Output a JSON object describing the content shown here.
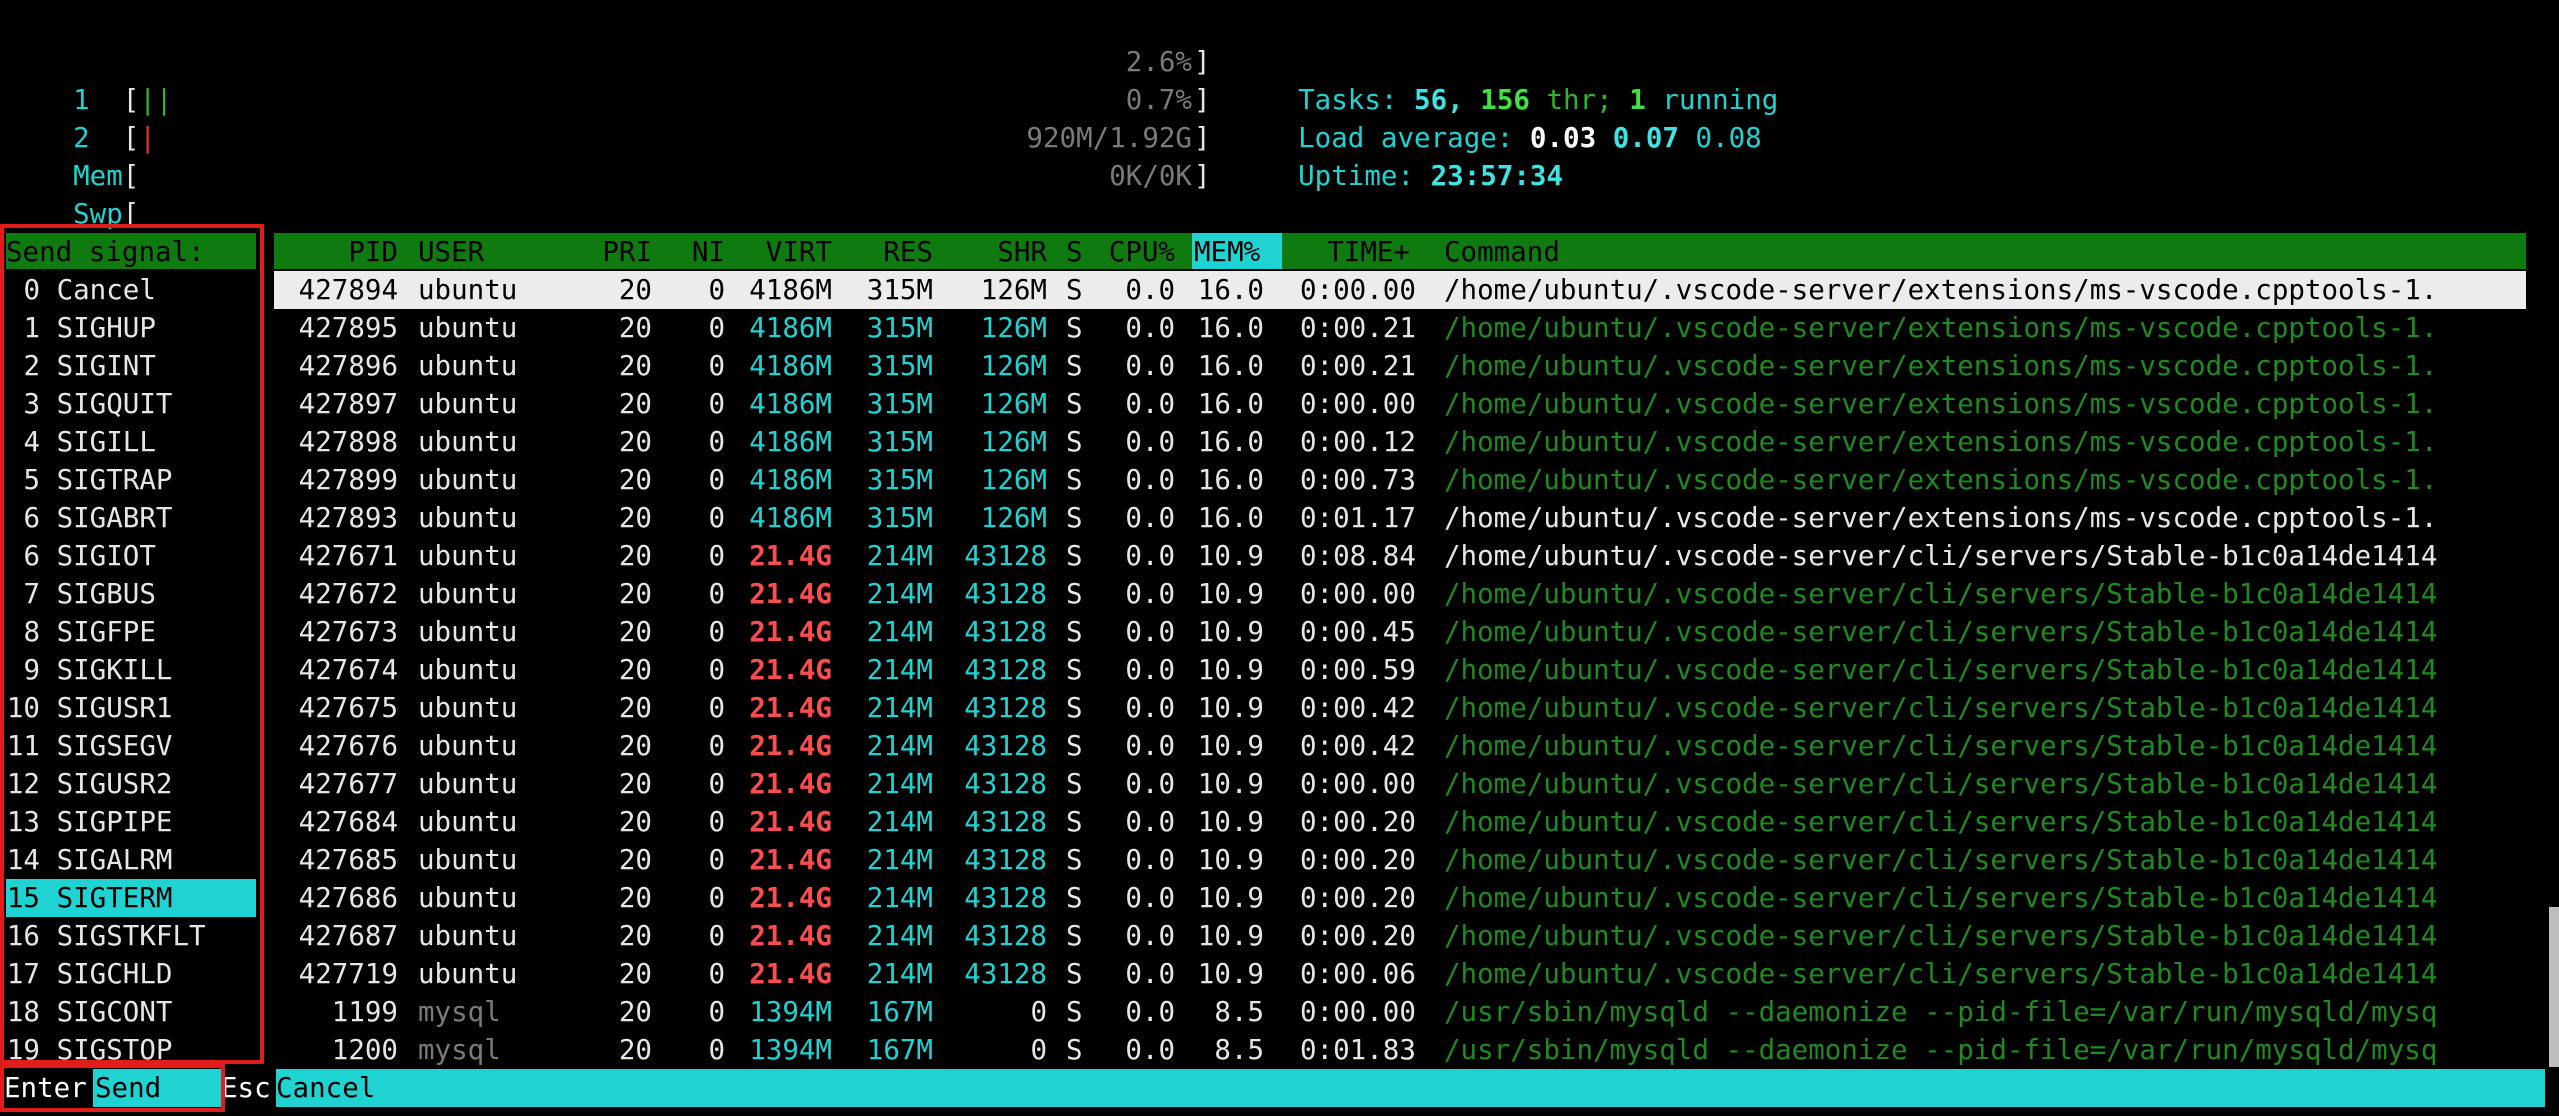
{
  "meters": {
    "cpu1": {
      "label": "1",
      "bar": "||",
      "value": "2.6%"
    },
    "cpu2": {
      "label": "2",
      "bar": "|",
      "value": "0.7%"
    },
    "mem": {
      "label": "Mem",
      "bar_green": "||||||||||||||||||||||||||||||||||||||||||||||||||||||||||||||||||||||",
      "bar_blue": "|||",
      "bar_yellow": "||||||||||||||||||||||||||||||",
      "value": "920M/1.92G"
    },
    "swp": {
      "label": "Swp",
      "value": "0K/0K"
    }
  },
  "summary": {
    "tasks_label": "Tasks:",
    "tasks": "56,",
    "threads": "156",
    "thr_label": "thr;",
    "running": "1",
    "running_label": "running",
    "load_label": "Load average:",
    "load1": "0.03",
    "load5": "0.07",
    "load15": "0.08",
    "uptime_label": "Uptime:",
    "uptime": "23:57:34"
  },
  "signal_panel": {
    "title": "Send signal:",
    "items": [
      {
        "num": "0",
        "name": "Cancel"
      },
      {
        "num": "1",
        "name": "SIGHUP"
      },
      {
        "num": "2",
        "name": "SIGINT"
      },
      {
        "num": "3",
        "name": "SIGQUIT"
      },
      {
        "num": "4",
        "name": "SIGILL"
      },
      {
        "num": "5",
        "name": "SIGTRAP"
      },
      {
        "num": "6",
        "name": "SIGABRT"
      },
      {
        "num": "6",
        "name": "SIGIOT"
      },
      {
        "num": "7",
        "name": "SIGBUS"
      },
      {
        "num": "8",
        "name": "SIGFPE"
      },
      {
        "num": "9",
        "name": "SIGKILL"
      },
      {
        "num": "10",
        "name": "SIGUSR1"
      },
      {
        "num": "11",
        "name": "SIGSEGV"
      },
      {
        "num": "12",
        "name": "SIGUSR2"
      },
      {
        "num": "13",
        "name": "SIGPIPE"
      },
      {
        "num": "14",
        "name": "SIGALRM"
      },
      {
        "num": "15",
        "name": "SIGTERM"
      },
      {
        "num": "16",
        "name": "SIGSTKFLT"
      },
      {
        "num": "17",
        "name": "SIGCHLD"
      },
      {
        "num": "18",
        "name": "SIGCONT"
      },
      {
        "num": "19",
        "name": "SIGSTOP"
      }
    ],
    "selected_index": 16
  },
  "table": {
    "headers": {
      "pid": "PID",
      "user": "USER",
      "pri": "PRI",
      "ni": "NI",
      "virt": "VIRT",
      "res": "RES",
      "shr": "SHR",
      "s": "S",
      "cpu": "CPU%",
      "mem": "MEM%",
      "time": "TIME+",
      "command": "Command"
    },
    "rows": [
      {
        "pid": "427894",
        "user": "ubuntu",
        "pri": "20",
        "ni": "0",
        "virt": "4186M",
        "res": "315M",
        "shr": "126M",
        "s": "S",
        "cpu": "0.0",
        "mem": "16.0",
        "time": "0:00.00",
        "cmd": "/home/ubuntu/.vscode-server/extensions/ms-vscode.cpptools-1.",
        "kind": "sel"
      },
      {
        "pid": "427895",
        "user": "ubuntu",
        "pri": "20",
        "ni": "0",
        "virt": "4186M",
        "res": "315M",
        "shr": "126M",
        "s": "S",
        "cpu": "0.0",
        "mem": "16.0",
        "time": "0:00.21",
        "cmd": "/home/ubuntu/.vscode-server/extensions/ms-vscode.cpptools-1.",
        "kind": "thr"
      },
      {
        "pid": "427896",
        "user": "ubuntu",
        "pri": "20",
        "ni": "0",
        "virt": "4186M",
        "res": "315M",
        "shr": "126M",
        "s": "S",
        "cpu": "0.0",
        "mem": "16.0",
        "time": "0:00.21",
        "cmd": "/home/ubuntu/.vscode-server/extensions/ms-vscode.cpptools-1.",
        "kind": "thr"
      },
      {
        "pid": "427897",
        "user": "ubuntu",
        "pri": "20",
        "ni": "0",
        "virt": "4186M",
        "res": "315M",
        "shr": "126M",
        "s": "S",
        "cpu": "0.0",
        "mem": "16.0",
        "time": "0:00.00",
        "cmd": "/home/ubuntu/.vscode-server/extensions/ms-vscode.cpptools-1.",
        "kind": "thr"
      },
      {
        "pid": "427898",
        "user": "ubuntu",
        "pri": "20",
        "ni": "0",
        "virt": "4186M",
        "res": "315M",
        "shr": "126M",
        "s": "S",
        "cpu": "0.0",
        "mem": "16.0",
        "time": "0:00.12",
        "cmd": "/home/ubuntu/.vscode-server/extensions/ms-vscode.cpptools-1.",
        "kind": "thr"
      },
      {
        "pid": "427899",
        "user": "ubuntu",
        "pri": "20",
        "ni": "0",
        "virt": "4186M",
        "res": "315M",
        "shr": "126M",
        "s": "S",
        "cpu": "0.0",
        "mem": "16.0",
        "time": "0:00.73",
        "cmd": "/home/ubuntu/.vscode-server/extensions/ms-vscode.cpptools-1.",
        "kind": "thr"
      },
      {
        "pid": "427893",
        "user": "ubuntu",
        "pri": "20",
        "ni": "0",
        "virt": "4186M",
        "res": "315M",
        "shr": "126M",
        "s": "S",
        "cpu": "0.0",
        "mem": "16.0",
        "time": "0:01.17",
        "cmd": "/home/ubuntu/.vscode-server/extensions/ms-vscode.cpptools-1.",
        "kind": "proc"
      },
      {
        "pid": "427671",
        "user": "ubuntu",
        "pri": "20",
        "ni": "0",
        "virt": "21.4G",
        "res": "214M",
        "shr": "43128",
        "s": "S",
        "cpu": "0.0",
        "mem": "10.9",
        "time": "0:08.84",
        "cmd": "/home/ubuntu/.vscode-server/cli/servers/Stable-b1c0a14de1414",
        "kind": "proc_big"
      },
      {
        "pid": "427672",
        "user": "ubuntu",
        "pri": "20",
        "ni": "0",
        "virt": "21.4G",
        "res": "214M",
        "shr": "43128",
        "s": "S",
        "cpu": "0.0",
        "mem": "10.9",
        "time": "0:00.00",
        "cmd": "/home/ubuntu/.vscode-server/cli/servers/Stable-b1c0a14de1414",
        "kind": "thr_big"
      },
      {
        "pid": "427673",
        "user": "ubuntu",
        "pri": "20",
        "ni": "0",
        "virt": "21.4G",
        "res": "214M",
        "shr": "43128",
        "s": "S",
        "cpu": "0.0",
        "mem": "10.9",
        "time": "0:00.45",
        "cmd": "/home/ubuntu/.vscode-server/cli/servers/Stable-b1c0a14de1414",
        "kind": "thr_big"
      },
      {
        "pid": "427674",
        "user": "ubuntu",
        "pri": "20",
        "ni": "0",
        "virt": "21.4G",
        "res": "214M",
        "shr": "43128",
        "s": "S",
        "cpu": "0.0",
        "mem": "10.9",
        "time": "0:00.59",
        "cmd": "/home/ubuntu/.vscode-server/cli/servers/Stable-b1c0a14de1414",
        "kind": "thr_big"
      },
      {
        "pid": "427675",
        "user": "ubuntu",
        "pri": "20",
        "ni": "0",
        "virt": "21.4G",
        "res": "214M",
        "shr": "43128",
        "s": "S",
        "cpu": "0.0",
        "mem": "10.9",
        "time": "0:00.42",
        "cmd": "/home/ubuntu/.vscode-server/cli/servers/Stable-b1c0a14de1414",
        "kind": "thr_big"
      },
      {
        "pid": "427676",
        "user": "ubuntu",
        "pri": "20",
        "ni": "0",
        "virt": "21.4G",
        "res": "214M",
        "shr": "43128",
        "s": "S",
        "cpu": "0.0",
        "mem": "10.9",
        "time": "0:00.42",
        "cmd": "/home/ubuntu/.vscode-server/cli/servers/Stable-b1c0a14de1414",
        "kind": "thr_big"
      },
      {
        "pid": "427677",
        "user": "ubuntu",
        "pri": "20",
        "ni": "0",
        "virt": "21.4G",
        "res": "214M",
        "shr": "43128",
        "s": "S",
        "cpu": "0.0",
        "mem": "10.9",
        "time": "0:00.00",
        "cmd": "/home/ubuntu/.vscode-server/cli/servers/Stable-b1c0a14de1414",
        "kind": "thr_big"
      },
      {
        "pid": "427684",
        "user": "ubuntu",
        "pri": "20",
        "ni": "0",
        "virt": "21.4G",
        "res": "214M",
        "shr": "43128",
        "s": "S",
        "cpu": "0.0",
        "mem": "10.9",
        "time": "0:00.20",
        "cmd": "/home/ubuntu/.vscode-server/cli/servers/Stable-b1c0a14de1414",
        "kind": "thr_big"
      },
      {
        "pid": "427685",
        "user": "ubuntu",
        "pri": "20",
        "ni": "0",
        "virt": "21.4G",
        "res": "214M",
        "shr": "43128",
        "s": "S",
        "cpu": "0.0",
        "mem": "10.9",
        "time": "0:00.20",
        "cmd": "/home/ubuntu/.vscode-server/cli/servers/Stable-b1c0a14de1414",
        "kind": "thr_big"
      },
      {
        "pid": "427686",
        "user": "ubuntu",
        "pri": "20",
        "ni": "0",
        "virt": "21.4G",
        "res": "214M",
        "shr": "43128",
        "s": "S",
        "cpu": "0.0",
        "mem": "10.9",
        "time": "0:00.20",
        "cmd": "/home/ubuntu/.vscode-server/cli/servers/Stable-b1c0a14de1414",
        "kind": "thr_big"
      },
      {
        "pid": "427687",
        "user": "ubuntu",
        "pri": "20",
        "ni": "0",
        "virt": "21.4G",
        "res": "214M",
        "shr": "43128",
        "s": "S",
        "cpu": "0.0",
        "mem": "10.9",
        "time": "0:00.20",
        "cmd": "/home/ubuntu/.vscode-server/cli/servers/Stable-b1c0a14de1414",
        "kind": "thr_big"
      },
      {
        "pid": "427719",
        "user": "ubuntu",
        "pri": "20",
        "ni": "0",
        "virt": "21.4G",
        "res": "214M",
        "shr": "43128",
        "s": "S",
        "cpu": "0.0",
        "mem": "10.9",
        "time": "0:00.06",
        "cmd": "/home/ubuntu/.vscode-server/cli/servers/Stable-b1c0a14de1414",
        "kind": "thr_big"
      },
      {
        "pid": "1199",
        "user": "mysql",
        "pri": "20",
        "ni": "0",
        "virt": "1394M",
        "res": "167M",
        "shr": "0",
        "s": "S",
        "cpu": "0.0",
        "mem": "8.5",
        "time": "0:00.00",
        "cmd": "/usr/sbin/mysqld --daemonize --pid-file=/var/run/mysqld/mysq",
        "kind": "thr_mysql"
      },
      {
        "pid": "1200",
        "user": "mysql",
        "pri": "20",
        "ni": "0",
        "virt": "1394M",
        "res": "167M",
        "shr": "0",
        "s": "S",
        "cpu": "0.0",
        "mem": "8.5",
        "time": "0:01.83",
        "cmd": "/usr/sbin/mysqld --daemonize --pid-file=/var/run/mysqld/mysq",
        "kind": "thr_mysql"
      }
    ]
  },
  "footer": {
    "enter_key": "Enter",
    "send_label": "Send",
    "esc_key": "Esc",
    "cancel_label": "Cancel"
  },
  "colors": {
    "cyan": "#1fd3d3",
    "header_green": "#0f7a0f",
    "highlight_red": "#e01c1c",
    "virt_red": "#ff4d4d"
  }
}
